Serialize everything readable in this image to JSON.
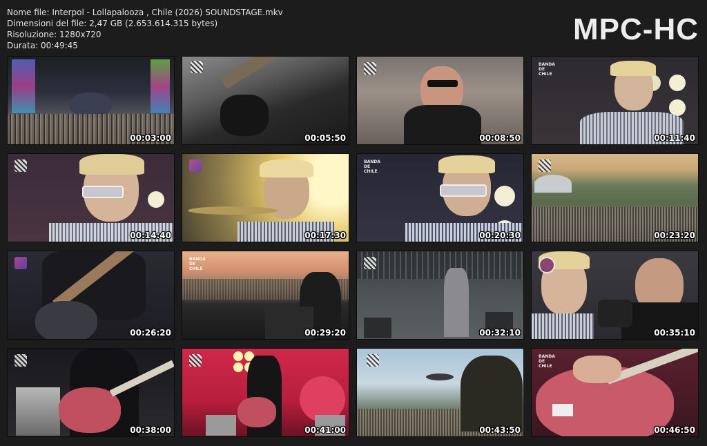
{
  "file_info": {
    "name_line": "Nome file: Interpol - Lollapalooza , Chile (2026) SOUNDSTAGE.mkv",
    "size_line": "Dimensioni del file: 2,47 GB (2.653.614.315 bytes)",
    "resolution_line": "Risoluzione: 1280x720",
    "duration_line": "Durata: 00:49:45"
  },
  "logo": "MPC-HC",
  "thumbnails": [
    {
      "time": "00:03:00",
      "scene": "festival crowd wide shot"
    },
    {
      "time": "00:05:50",
      "scene": "bass guitar close-up"
    },
    {
      "time": "00:08:50",
      "scene": "singer in sunglasses"
    },
    {
      "time": "00:11:40",
      "scene": "singer at microphone"
    },
    {
      "time": "00:14:40",
      "scene": "singer close-up"
    },
    {
      "time": "00:17:30",
      "scene": "singer backlit by sun"
    },
    {
      "time": "00:20:30",
      "scene": "singer at microphone"
    },
    {
      "time": "00:23:20",
      "scene": "aerial view of festival"
    },
    {
      "time": "00:26:20",
      "scene": "bassist playing"
    },
    {
      "time": "00:29:20",
      "scene": "drummer at sunset"
    },
    {
      "time": "00:32:10",
      "scene": "band on stage"
    },
    {
      "time": "00:35:10",
      "scene": "singer and guitarist"
    },
    {
      "time": "00:38:00",
      "scene": "guitarist with red guitar"
    },
    {
      "time": "00:41:00",
      "scene": "guitarist on red lit stage"
    },
    {
      "time": "00:43:50",
      "scene": "drummer over crowd"
    },
    {
      "time": "00:46:50",
      "scene": "red guitar close-up"
    }
  ]
}
